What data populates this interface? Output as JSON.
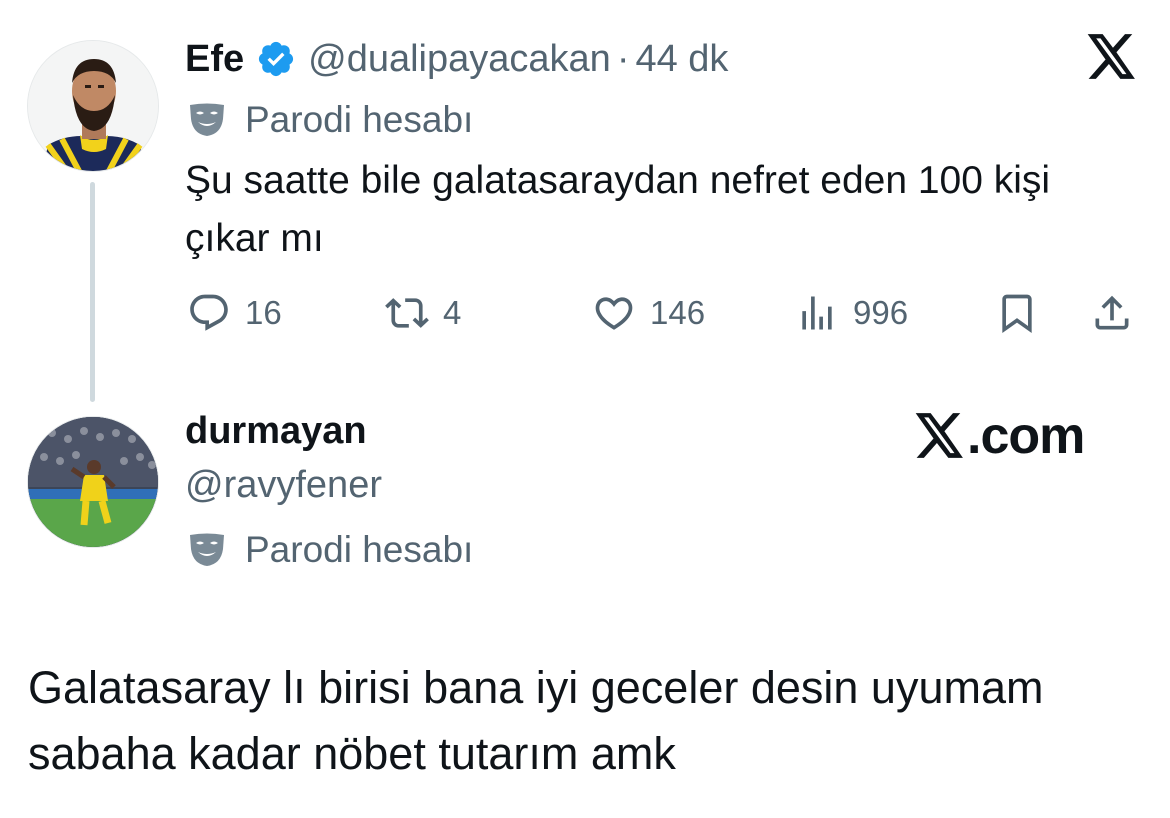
{
  "tweet1": {
    "display_name": "Efe",
    "handle": "@dualipayacakan",
    "separator": "·",
    "time": "44 dk",
    "parody_label": "Parodi hesabı",
    "text": "Şu saatte bile galatasaraydan nefret eden 100 kişi çıkar mı",
    "stats": {
      "replies": "16",
      "reposts": "4",
      "likes": "146",
      "views": "996"
    },
    "verified_color": "#1d9bf0"
  },
  "tweet2": {
    "display_name": "durmayan",
    "handle": "@ravyfener",
    "parody_label": "Parodi hesabı",
    "text": "Galatasaray lı birisi bana iyi geceler desin uyumam sabaha kadar nöbet tutarım amk"
  },
  "watermark": ".com",
  "icons": {
    "verified": "verified-badge-icon",
    "parody": "parody-mask-icon",
    "reply": "reply-icon",
    "repost": "repost-icon",
    "like": "heart-icon",
    "views": "views-chart-icon",
    "bookmark": "bookmark-icon",
    "share": "share-icon",
    "x_logo": "x-logo-icon"
  },
  "colors": {
    "text": "#0f1419",
    "secondary": "#536471",
    "thread_line": "#cfd9de"
  }
}
